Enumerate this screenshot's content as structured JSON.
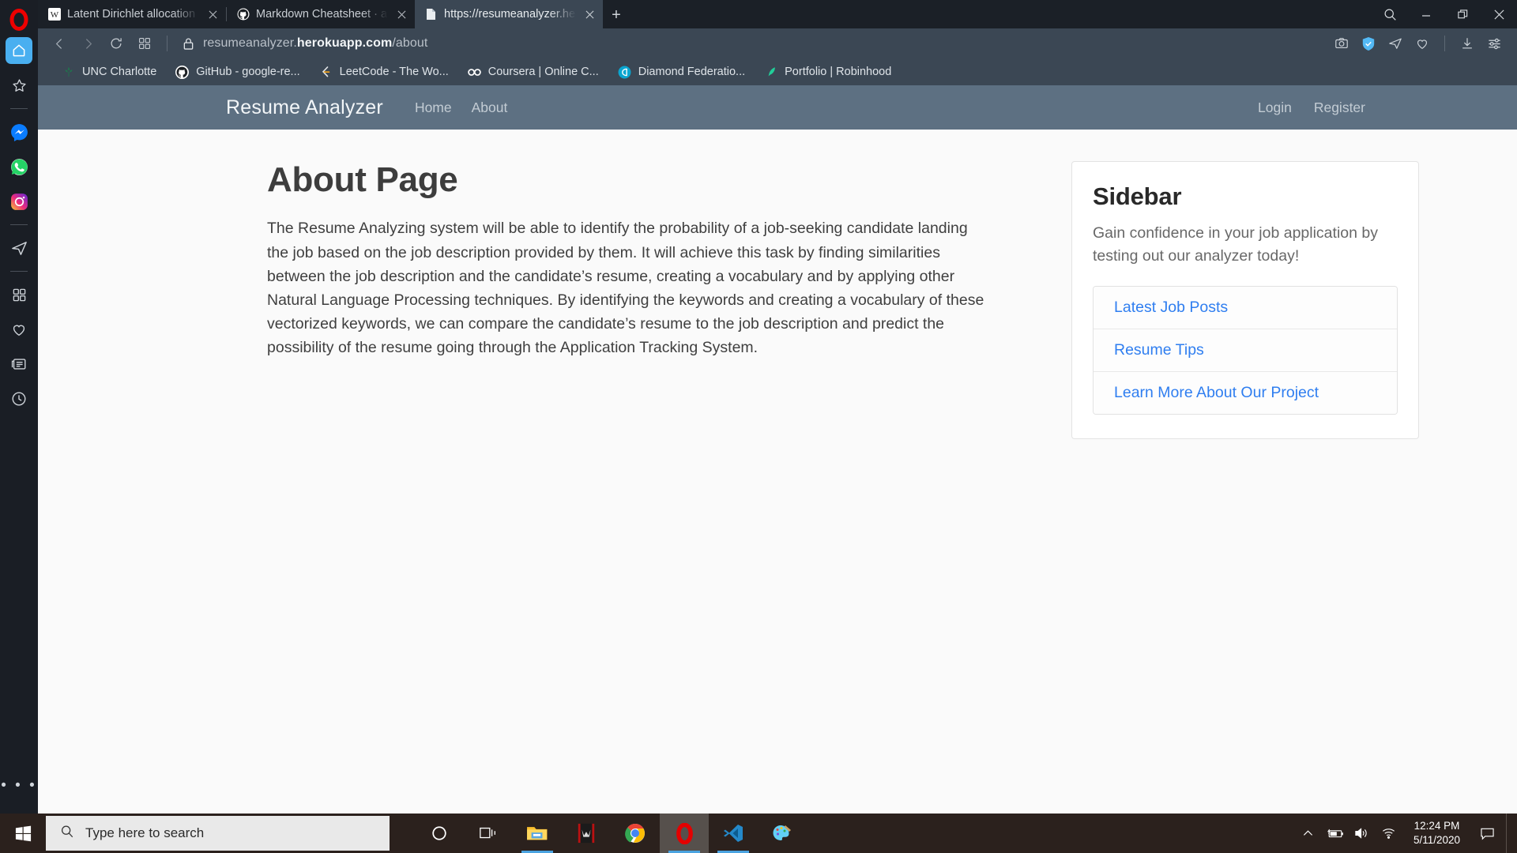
{
  "browser": {
    "name": "Opera",
    "tabs": [
      {
        "title": "Latent Dirichlet allocation -",
        "favicon": "wikipedia-icon",
        "active": false
      },
      {
        "title": "Markdown Cheatsheet · ad",
        "favicon": "github-icon",
        "active": false
      },
      {
        "title": "https://resumeanalyzer.her",
        "favicon": "page-icon",
        "active": true
      }
    ],
    "new_tab_label": "+",
    "window_controls": [
      "search-icon",
      "minimize-icon",
      "restore-icon",
      "close-icon"
    ],
    "toolbar": {
      "back": "back-icon",
      "forward": "forward-icon",
      "reload": "reload-icon",
      "speeddial": "grid-icon",
      "lock": "lock-icon",
      "url_prefix": "resumeanalyzer.",
      "url_domain": "herokuapp.com",
      "url_path": "/about",
      "url_full": "resumeanalyzer.herokuapp.com/about",
      "right_icons": [
        "snapshot-icon",
        "vpn-shield-icon",
        "send-icon",
        "heart-icon",
        "download-icon",
        "easy-setup-icon"
      ]
    },
    "bookmarks": [
      {
        "label": "UNC Charlotte",
        "icon": "unc-charlotte-icon"
      },
      {
        "label": "GitHub - google-re...",
        "icon": "github-icon"
      },
      {
        "label": "LeetCode - The Wo...",
        "icon": "leetcode-icon"
      },
      {
        "label": "Coursera | Online C...",
        "icon": "coursera-icon"
      },
      {
        "label": "Diamond Federatio...",
        "icon": "diamond-icon"
      },
      {
        "label": "Portfolio | Robinhood",
        "icon": "robinhood-icon"
      }
    ],
    "sidebar_icons": [
      "home-icon",
      "favorites-star-icon",
      "divider",
      "messenger-icon",
      "whatsapp-icon",
      "instagram-icon",
      "divider",
      "telegram-icon",
      "divider",
      "apps-grid-icon",
      "heart-icon",
      "news-icon",
      "history-clock-icon"
    ],
    "sidebar_more": "• • •"
  },
  "site": {
    "brand": "Resume Analyzer",
    "nav_links": [
      {
        "label": "Home",
        "href": "#"
      },
      {
        "label": "About",
        "href": "#"
      }
    ],
    "auth_links": [
      {
        "label": "Login",
        "href": "#"
      },
      {
        "label": "Register",
        "href": "#"
      }
    ],
    "nav_bg": "#5d7082",
    "main": {
      "title": "About Page",
      "body": "The Resume Analyzing system will be able to identify the probability of a job-seeking candidate landing the job based on the job description provided by them. It will achieve this task by finding similarities between the job description and the candidate’s resume, creating a vocabulary and by applying other Natural Language Processing techniques. By identifying the keywords and creating a vocabulary of these vectorized keywords, we can compare the candidate’s resume to the job description and predict the possibility of the resume going through the Application Tracking System."
    },
    "sidebar": {
      "title": "Sidebar",
      "lead": "Gain confidence in your job application by testing out our analyzer today!",
      "links": [
        {
          "label": "Latest Job Posts"
        },
        {
          "label": "Resume Tips"
        },
        {
          "label": "Learn More About Our Project"
        }
      ],
      "link_color": "#2f7ef0"
    }
  },
  "taskbar": {
    "start": "windows-start-icon",
    "search_placeholder": "Type here to search",
    "apps": [
      {
        "name": "cortana-icon",
        "running": false,
        "active": false
      },
      {
        "name": "task-view-icon",
        "running": false,
        "active": false
      },
      {
        "name": "file-explorer-icon",
        "running": true,
        "active": false
      },
      {
        "name": "predator-sense-icon",
        "running": false,
        "active": false
      },
      {
        "name": "google-chrome-icon",
        "running": false,
        "active": false
      },
      {
        "name": "opera-icon",
        "running": true,
        "active": true
      },
      {
        "name": "vscode-icon",
        "running": true,
        "active": false
      },
      {
        "name": "paint-3d-icon",
        "running": false,
        "active": false
      }
    ],
    "tray_icons": [
      "show-hidden-icons-chevron",
      "battery-charging-icon",
      "volume-icon",
      "wifi-icon"
    ],
    "time": "12:24 PM",
    "date": "5/11/2020",
    "action_center": "action-center-icon"
  }
}
